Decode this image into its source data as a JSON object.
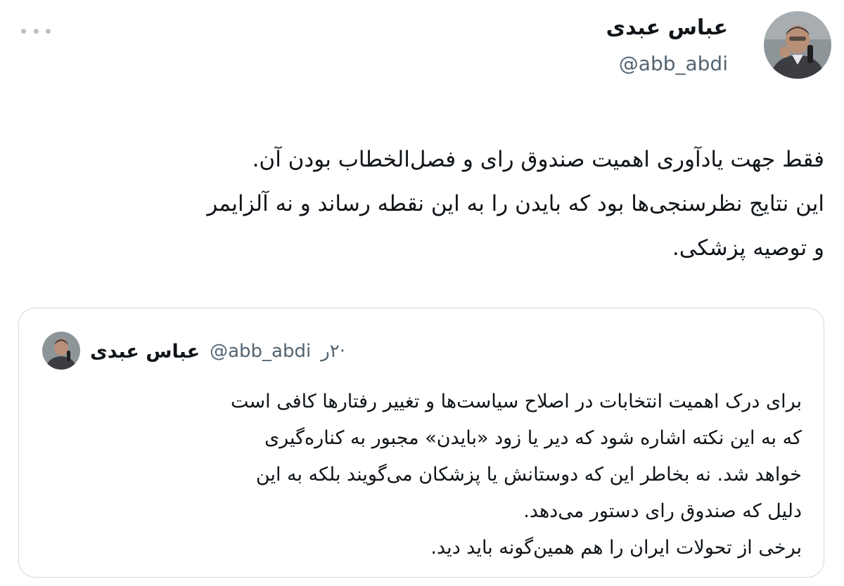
{
  "tweet": {
    "author": {
      "name": "عباس عبدی",
      "handle": "@abb_abdi",
      "avatar_icon": "profile-photo"
    },
    "more_icon": "more-horizontal-icon",
    "text": "فقط جهت یادآوری اهمیت صندوق رای و فصل‌الخطاب بودن آن.\nاین نتایج نظرسنجی‌ها بود که بایدن را به این نقطه رساند و نه آلزایمر\nو توصیه پزشکی."
  },
  "quote": {
    "author": {
      "name": "عباس عبدی",
      "handle": "@abb_abdi",
      "avatar_icon": "profile-photo"
    },
    "time": "·۲ر",
    "text": "برای درک اهمیت انتخابات در اصلاح سیاست‌ها و تغییر رفتارها کافی است\nکه به این نکته اشاره شود که دیر یا زود «بایدن» مجبور به کناره‌گیری\nخواهد شد. نه بخاطر این که دوستانش یا پزشکان می‌گویند بلکه به این\nدلیل که صندوق رای دستور می‌دهد.\nبرخی از تحولات ایران را هم همین‌گونه باید دید."
  },
  "colors": {
    "text": "#0f1419",
    "secondary": "#536471",
    "border": "#cfd9de",
    "more_dots": "#b9c0c6"
  }
}
